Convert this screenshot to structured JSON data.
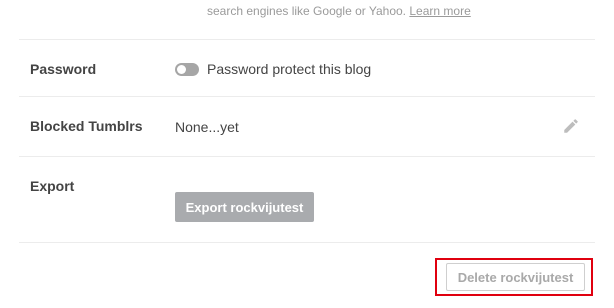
{
  "visibility": {
    "note_text": "search engines like Google or Yahoo.",
    "learn_more": "Learn more"
  },
  "password": {
    "label": "Password",
    "toggle_state": "off",
    "toggle_text": "Password protect this blog"
  },
  "blocked": {
    "label": "Blocked Tumblrs",
    "value": "None...yet",
    "edit_icon": "pencil-icon"
  },
  "export": {
    "label": "Export",
    "button_label": "Export rockvijutest"
  },
  "delete": {
    "button_label": "Delete rockvijutest"
  },
  "colors": {
    "annotation_box": "#e0000f",
    "export_button_bg": "#a9abae",
    "toggle_off": "#a6a6a6"
  }
}
